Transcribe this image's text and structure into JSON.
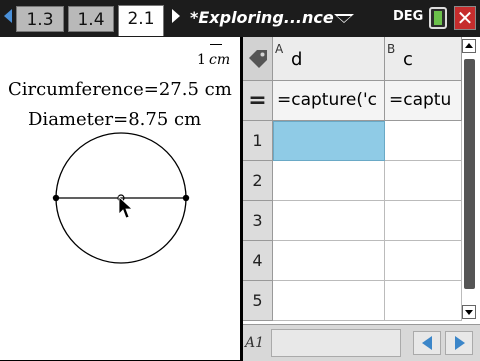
{
  "toolbar": {
    "tabs": [
      {
        "label": "1.3",
        "active": false
      },
      {
        "label": "1.4",
        "active": false
      },
      {
        "label": "2.1",
        "active": true
      }
    ],
    "document_title": "*Exploring...nce",
    "angle_mode": "DEG",
    "close_label": "✕",
    "icons": [
      "tab-left-arrow-icon",
      "tab-right-arrow-icon",
      "dropdown-icon",
      "battery-icon",
      "close-icon"
    ]
  },
  "geometry": {
    "scale_value": "1",
    "scale_unit": "cm",
    "circumference_text": "Circumference=27.5 cm",
    "diameter_text": "Diameter=8.75 cm"
  },
  "spreadsheet": {
    "columns": [
      {
        "letter": "A",
        "name": "d",
        "formula": "=capture('c"
      },
      {
        "letter": "B",
        "name": "c",
        "formula": "=captu"
      }
    ],
    "formula_row_label": "=",
    "rows": [
      "1",
      "2",
      "3",
      "4",
      "5"
    ],
    "selected_cell": "A1",
    "cell_ref": "A1"
  },
  "colors": {
    "selection": "#8fcbe6",
    "nav_arrow": "#3b86c9",
    "close": "#c62d2d",
    "battery": "#6bc14a"
  }
}
